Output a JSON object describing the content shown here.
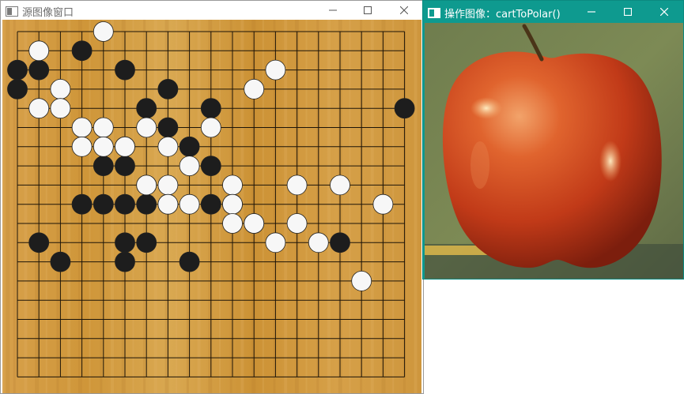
{
  "source_window": {
    "title": "源图像窗口",
    "controls": [
      "minimize",
      "maximize",
      "close"
    ],
    "image": {
      "subject": "go-board",
      "board_size": 19,
      "black_stones": [
        [
          7,
          14
        ],
        [
          5,
          13
        ],
        [
          4,
          12
        ],
        [
          6,
          11
        ],
        [
          3,
          10
        ],
        [
          4,
          10
        ],
        [
          5,
          10
        ],
        [
          6,
          10
        ],
        [
          7,
          10
        ],
        [
          5,
          12
        ],
        [
          1,
          8
        ],
        [
          2,
          7
        ],
        [
          6,
          8
        ],
        [
          5,
          8
        ],
        [
          5,
          7
        ],
        [
          8,
          13
        ],
        [
          8,
          7
        ],
        [
          9,
          12
        ],
        [
          11,
          9
        ],
        [
          9,
          10
        ],
        [
          10,
          10
        ],
        [
          6,
          15
        ],
        [
          7,
          16
        ],
        [
          5,
          17
        ],
        [
          3,
          18
        ],
        [
          0,
          17
        ],
        [
          1,
          17
        ],
        [
          0,
          16
        ],
        [
          9,
          15
        ],
        [
          15,
          8
        ],
        [
          18,
          15
        ]
      ],
      "white_stones": [
        [
          14,
          8
        ],
        [
          4,
          19
        ],
        [
          1,
          18
        ],
        [
          2,
          16
        ],
        [
          1,
          15
        ],
        [
          2,
          15
        ],
        [
          3,
          14
        ],
        [
          4,
          14
        ],
        [
          6,
          14
        ],
        [
          9,
          14
        ],
        [
          3,
          13
        ],
        [
          4,
          13
        ],
        [
          5,
          13
        ],
        [
          7,
          13
        ],
        [
          8,
          12
        ],
        [
          6,
          11
        ],
        [
          7,
          11
        ],
        [
          10,
          11
        ],
        [
          10,
          10
        ],
        [
          7,
          10
        ],
        [
          8,
          10
        ],
        [
          10,
          9
        ],
        [
          11,
          9
        ],
        [
          13,
          11
        ],
        [
          12,
          8
        ],
        [
          13,
          9
        ],
        [
          16,
          6
        ],
        [
          17,
          10
        ],
        [
          11,
          16
        ],
        [
          12,
          17
        ],
        [
          15,
          11
        ]
      ]
    }
  },
  "operation_window": {
    "title": "操作图像：cartToPolar()",
    "controls": [
      "minimize",
      "maximize",
      "close"
    ],
    "image": {
      "subject": "red-apple"
    }
  },
  "colors": {
    "titlebar_active": "#0e9a8f",
    "titlebar_inactive": "#ffffff",
    "board_wood": "#d29a40",
    "grid_line": "#1c1408",
    "black_stone": "#1d1d1d",
    "white_stone": "#f7f7f7",
    "apple_red": "#c8381b"
  }
}
